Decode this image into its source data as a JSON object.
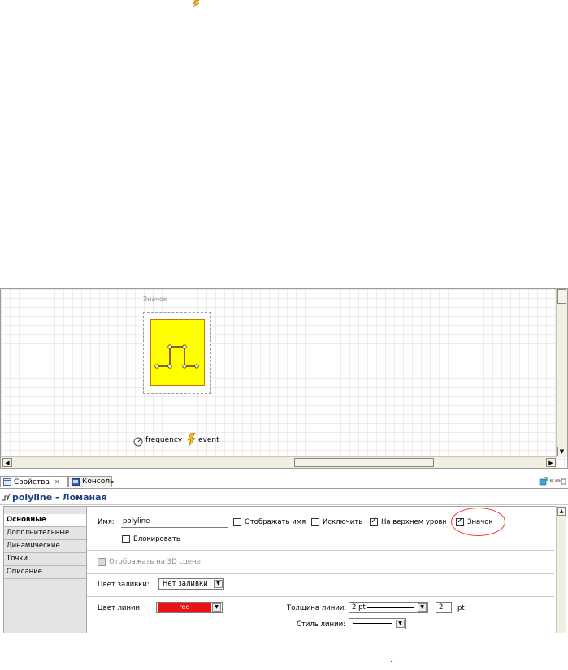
{
  "canvas": {
    "icon_caption": "Значок",
    "chips": [
      {
        "icon": "frequency-icon",
        "label": "frequency"
      },
      {
        "icon": "event-lightning-icon",
        "label": "event"
      }
    ]
  },
  "tabs": [
    {
      "label": "Свойства",
      "icon": "properties-icon",
      "close": "✕",
      "active": true
    },
    {
      "label": "Консоль",
      "icon": "console-icon",
      "active": false
    }
  ],
  "selection_title": "polyline - Ломаная",
  "side_nav": [
    {
      "label": "Основные",
      "active": true
    },
    {
      "label": "Дополнительные"
    },
    {
      "label": "Динамические"
    },
    {
      "label": "Точки"
    },
    {
      "label": "Описание"
    }
  ],
  "general": {
    "name_label": "Имя:",
    "name_value": "polyline",
    "show_name_label": "Отображать имя",
    "exclude_label": "Исключить",
    "top_level_label": "На верхнем уровне",
    "icon_label": "Значок",
    "lock_label": "Блокировать",
    "show3d_label": "Отображать на 3D сцене",
    "fill_label": "Цвет заливки:",
    "fill_value": "Нет заливки",
    "line_color_label": "Цвет линии:",
    "line_color_value": "red",
    "line_color_hex": "#ee1111",
    "thickness_label": "Толщина линии:",
    "thickness_value": "2 pt",
    "thickness_number": "2",
    "thickness_unit": "pt",
    "style_label": "Стиль линии:"
  },
  "checkbox_states": {
    "show_name": false,
    "exclude": false,
    "top_level": true,
    "icon": true,
    "lock": false,
    "show3d": false
  },
  "bottom_mark": "ˊ"
}
